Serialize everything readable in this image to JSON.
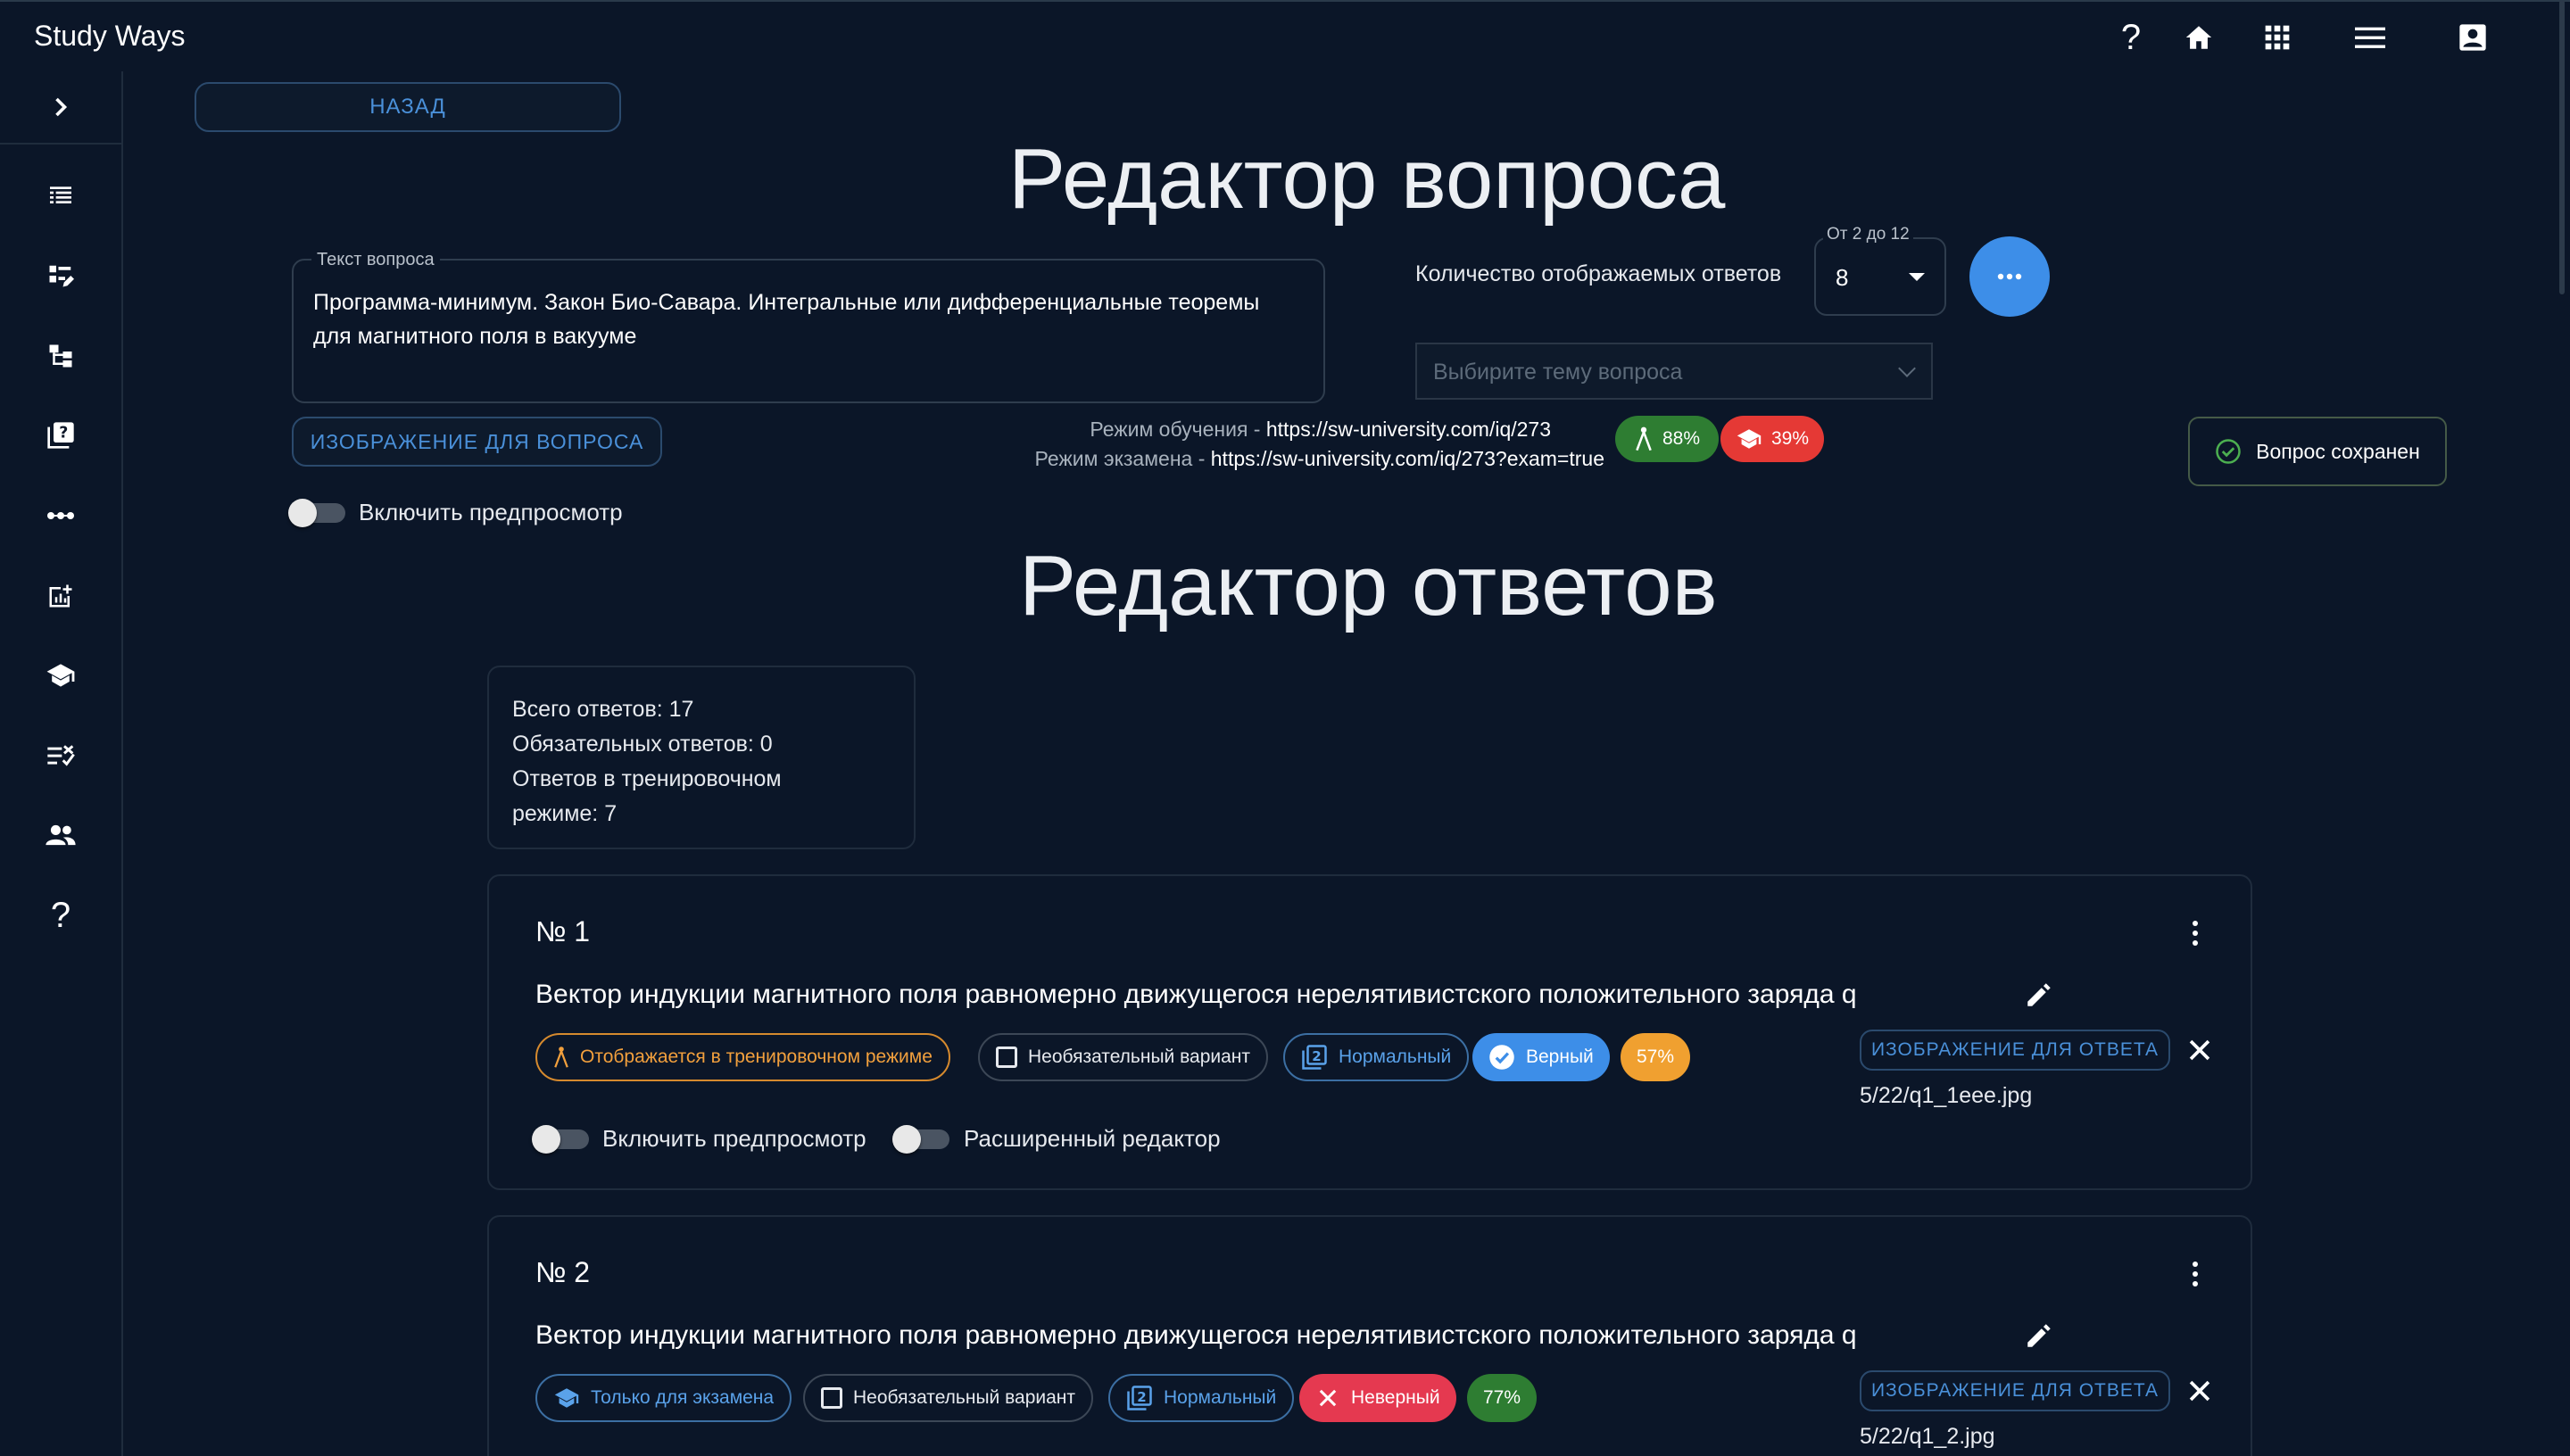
{
  "header": {
    "app_title": "Study Ways"
  },
  "nav": {
    "back_label": "НАЗАД"
  },
  "question_editor": {
    "title": "Редактор вопроса",
    "question_text_label": "Текст вопроса",
    "question_text": "Программа-минимум. Закон Био-Савара. Интегральные или дифференциальные теоремы для магнитного поля в вакууме",
    "image_button_label": "ИЗОБРАЖЕНИЕ ДЛЯ ВОПРОСА",
    "preview_toggle_label": "Включить предпросмотр",
    "answers_count_label": "Количество отображаемых ответов",
    "answers_count_range": "От 2 до 12",
    "answers_count_value": "8",
    "topic_placeholder": "Выбирите тему вопроса",
    "training_mode_label": "Режим обучения - ",
    "training_mode_url": "https://sw-university.com/iq/273",
    "exam_mode_label": "Режим экзамена - ",
    "exam_mode_url": "https://sw-university.com/iq/273?exam=true",
    "training_pct": "88%",
    "exam_pct": "39%",
    "saved_label": "Вопрос сохранен"
  },
  "answers_editor": {
    "title": "Редактор ответов",
    "stats": {
      "total": "Всего ответов: 17",
      "required": "Обязательных ответов: 0",
      "training_line1": "Ответов в тренировочном",
      "training_line2": "режиме: 7"
    },
    "answers": [
      {
        "number": "№ 1",
        "text": "Вектор индукции магнитного поля равномерно движущегося нерелятивистского положительного заряда q",
        "mode_chip": "Отображается в тренировочном режиме",
        "optional_chip": "Необязательный вариант",
        "difficulty_chip": "Нормальный",
        "correctness_chip": "Верный",
        "pct": "57%",
        "image_button": "ИЗОБРАЖЕНИЕ ДЛЯ ОТВЕТА",
        "file": "5/22/q1_1eee.jpg",
        "preview_label": "Включить предпросмотр",
        "advanced_label": "Расширенный редактор"
      },
      {
        "number": "№ 2",
        "text": "Вектор индукции магнитного поля равномерно движущегося нерелятивистского положительного заряда q",
        "mode_chip": "Только для экзамена",
        "optional_chip": "Необязательный вариант",
        "difficulty_chip": "Нормальный",
        "correctness_chip": "Неверный",
        "pct": "77%",
        "image_button": "ИЗОБРАЖЕНИЕ ДЛЯ ОТВЕТА",
        "file": "5/22/q1_2.jpg"
      }
    ]
  },
  "icons": {
    "help": "help-icon",
    "home": "home-icon",
    "apps": "apps-grid-icon",
    "menu": "menu-icon",
    "account": "account-box-icon"
  },
  "colors": {
    "background": "#0b1628",
    "accent": "#3d8ee8",
    "success": "#2e7d32",
    "danger": "#e53935",
    "warning": "#f0a030"
  }
}
